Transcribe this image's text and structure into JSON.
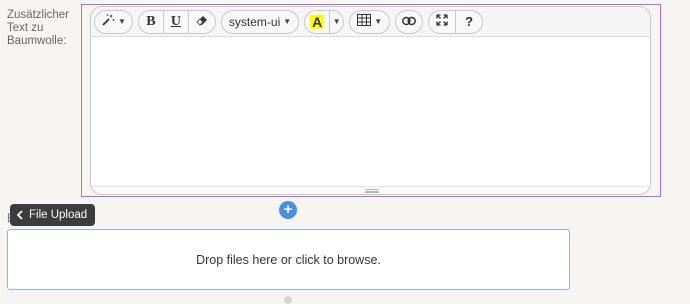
{
  "field": {
    "label_lines": [
      "Zusätzlicher",
      "Text zu",
      "Baumwolle:"
    ]
  },
  "toolbar": {
    "font_name": "system-ui",
    "bold_label": "B",
    "underline_label": "U",
    "highlight_label": "A",
    "help_label": "?",
    "icons": [
      "magic-icon",
      "eraser-icon",
      "table-icon",
      "link-icon",
      "fullscreen-icon"
    ]
  },
  "upload": {
    "tooltip_label": "File Upload",
    "hidden_label_start": "E",
    "hidden_label_end": ":",
    "dropzone_text": "Drop files here or click to browse."
  },
  "colors": {
    "focus_outline": "#b36ae2",
    "add_button": "#4a90e2",
    "dropzone_border": "#8fb5e8",
    "highlight": "#ffff00"
  }
}
